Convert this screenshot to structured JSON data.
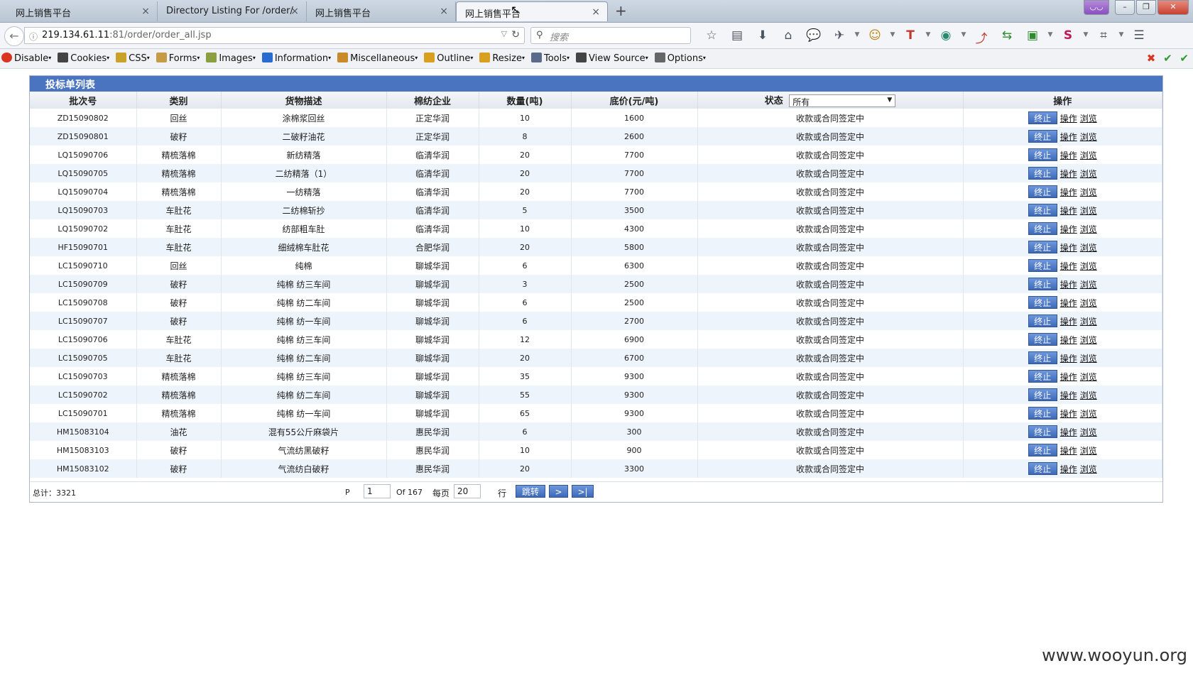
{
  "browser": {
    "tabs": [
      {
        "title": "网上销售平台",
        "active": false
      },
      {
        "title": "Directory Listing For /order/",
        "active": false
      },
      {
        "title": "网上销售平台",
        "active": false
      },
      {
        "title": "网上销售平台",
        "active": true
      }
    ],
    "url_host": "219.134.61.11",
    "url_path": ":81/order/order_all.jsp",
    "search_placeholder": "搜索",
    "close_glyph": "×",
    "new_tab_glyph": "+"
  },
  "devbar": {
    "items": [
      "Disable",
      "Cookies",
      "CSS",
      "Forms",
      "Images",
      "Information",
      "Miscellaneous",
      "Outline",
      "Resize",
      "Tools",
      "View Source",
      "Options"
    ],
    "icon_colors": [
      "#d8341f",
      "#444444",
      "#c9a227",
      "#c59b45",
      "#8aa040",
      "#2a6bd1",
      "#c98a2a",
      "#d9a020",
      "#d9a020",
      "#5a6a8a",
      "#444444",
      "#666666"
    ]
  },
  "panel": {
    "title": "投标单列表",
    "columns": [
      "批次号",
      "类别",
      "货物描述",
      "棉纺企业",
      "数量(吨)",
      "底价(元/吨)",
      "状态",
      "操作"
    ],
    "status_filter": "所有",
    "stop_label": "终止",
    "operate_label": "操作",
    "view_label": "浏览"
  },
  "rows": [
    {
      "batch": "ZD15090802",
      "category": "回丝",
      "desc": "涂棉浆回丝",
      "mill": "正定华润",
      "qty": "10",
      "price": "1600",
      "status": "收款或合同签定中"
    },
    {
      "batch": "ZD15090801",
      "category": "破籽",
      "desc": "二破籽油花",
      "mill": "正定华润",
      "qty": "8",
      "price": "2600",
      "status": "收款或合同签定中"
    },
    {
      "batch": "LQ15090706",
      "category": "精梳落棉",
      "desc": "新纺精落",
      "mill": "临清华润",
      "qty": "20",
      "price": "7700",
      "status": "收款或合同签定中"
    },
    {
      "batch": "LQ15090705",
      "category": "精梳落棉",
      "desc": "二纺精落（1）",
      "mill": "临清华润",
      "qty": "20",
      "price": "7700",
      "status": "收款或合同签定中"
    },
    {
      "batch": "LQ15090704",
      "category": "精梳落棉",
      "desc": "一纺精落",
      "mill": "临清华润",
      "qty": "20",
      "price": "7700",
      "status": "收款或合同签定中"
    },
    {
      "batch": "LQ15090703",
      "category": "车肚花",
      "desc": "二纺棉斩抄",
      "mill": "临清华润",
      "qty": "5",
      "price": "3500",
      "status": "收款或合同签定中"
    },
    {
      "batch": "LQ15090702",
      "category": "车肚花",
      "desc": "纺部粗车肚",
      "mill": "临清华润",
      "qty": "10",
      "price": "4300",
      "status": "收款或合同签定中"
    },
    {
      "batch": "HF15090701",
      "category": "车肚花",
      "desc": "细绒棉车肚花",
      "mill": "合肥华润",
      "qty": "20",
      "price": "5800",
      "status": "收款或合同签定中"
    },
    {
      "batch": "LC15090710",
      "category": "回丝",
      "desc": "纯棉",
      "mill": "聊城华润",
      "qty": "6",
      "price": "6300",
      "status": "收款或合同签定中"
    },
    {
      "batch": "LC15090709",
      "category": "破籽",
      "desc": "纯棉 纺三车间",
      "mill": "聊城华润",
      "qty": "3",
      "price": "2500",
      "status": "收款或合同签定中"
    },
    {
      "batch": "LC15090708",
      "category": "破籽",
      "desc": "纯棉 纺二车间",
      "mill": "聊城华润",
      "qty": "6",
      "price": "2500",
      "status": "收款或合同签定中"
    },
    {
      "batch": "LC15090707",
      "category": "破籽",
      "desc": "纯棉 纺一车间",
      "mill": "聊城华润",
      "qty": "6",
      "price": "2700",
      "status": "收款或合同签定中"
    },
    {
      "batch": "LC15090706",
      "category": "车肚花",
      "desc": "纯棉 纺三车间",
      "mill": "聊城华润",
      "qty": "12",
      "price": "6900",
      "status": "收款或合同签定中"
    },
    {
      "batch": "LC15090705",
      "category": "车肚花",
      "desc": "纯棉 纺二车间",
      "mill": "聊城华润",
      "qty": "20",
      "price": "6700",
      "status": "收款或合同签定中"
    },
    {
      "batch": "LC15090703",
      "category": "精梳落棉",
      "desc": "纯棉 纺三车间",
      "mill": "聊城华润",
      "qty": "35",
      "price": "9300",
      "status": "收款或合同签定中"
    },
    {
      "batch": "LC15090702",
      "category": "精梳落棉",
      "desc": "纯棉 纺二车间",
      "mill": "聊城华润",
      "qty": "55",
      "price": "9300",
      "status": "收款或合同签定中"
    },
    {
      "batch": "LC15090701",
      "category": "精梳落棉",
      "desc": "纯棉 纺一车间",
      "mill": "聊城华润",
      "qty": "65",
      "price": "9300",
      "status": "收款或合同签定中"
    },
    {
      "batch": "HM15083104",
      "category": "油花",
      "desc": "混有55公斤麻袋片",
      "mill": "惠民华润",
      "qty": "6",
      "price": "300",
      "status": "收款或合同签定中"
    },
    {
      "batch": "HM15083103",
      "category": "破籽",
      "desc": "气流纺黑破籽",
      "mill": "惠民华润",
      "qty": "10",
      "price": "900",
      "status": "收款或合同签定中"
    },
    {
      "batch": "HM15083102",
      "category": "破籽",
      "desc": "气流纺白破籽",
      "mill": "惠民华润",
      "qty": "20",
      "price": "3300",
      "status": "收款或合同签定中"
    }
  ],
  "pager": {
    "total_label": "总计：3321",
    "p_label": "P",
    "page_value": "1",
    "of_label": "Of 167",
    "per_page_label": "每页",
    "per_page_value": "20",
    "rows_label": "行",
    "jump_label": "跳转",
    "next_label": ">",
    "last_label": ">|"
  },
  "watermark": "www.wooyun.org",
  "colors": {
    "header_blue": "#4a73c0",
    "button_blue": "#4f7bc8",
    "row_alt": "#eef4fb"
  }
}
